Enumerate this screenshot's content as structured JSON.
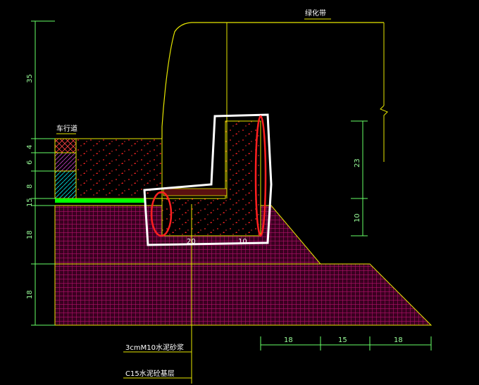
{
  "labels": {
    "greenbelt": "绿化带",
    "roadway": "车行道",
    "mortar": "3cmM10水泥砂浆",
    "base": "C15水泥砼基层"
  },
  "dims_left": [
    "35",
    "4",
    "6",
    "8",
    "15",
    "18",
    "18"
  ],
  "dims_right": [
    "23",
    "10"
  ],
  "dims_bottom": [
    "18",
    "15",
    "18"
  ],
  "dims_inner": [
    "20",
    "10"
  ],
  "colors": {
    "background": "#000000",
    "outline": "#e6e600",
    "dim_line": "#66ff66",
    "hatch_magenta": "#b0106a",
    "concrete_dot": "#ff2222",
    "highlight_white": "#ffffff",
    "highlight_red": "#ff2020",
    "bright_green": "#00ff00"
  }
}
